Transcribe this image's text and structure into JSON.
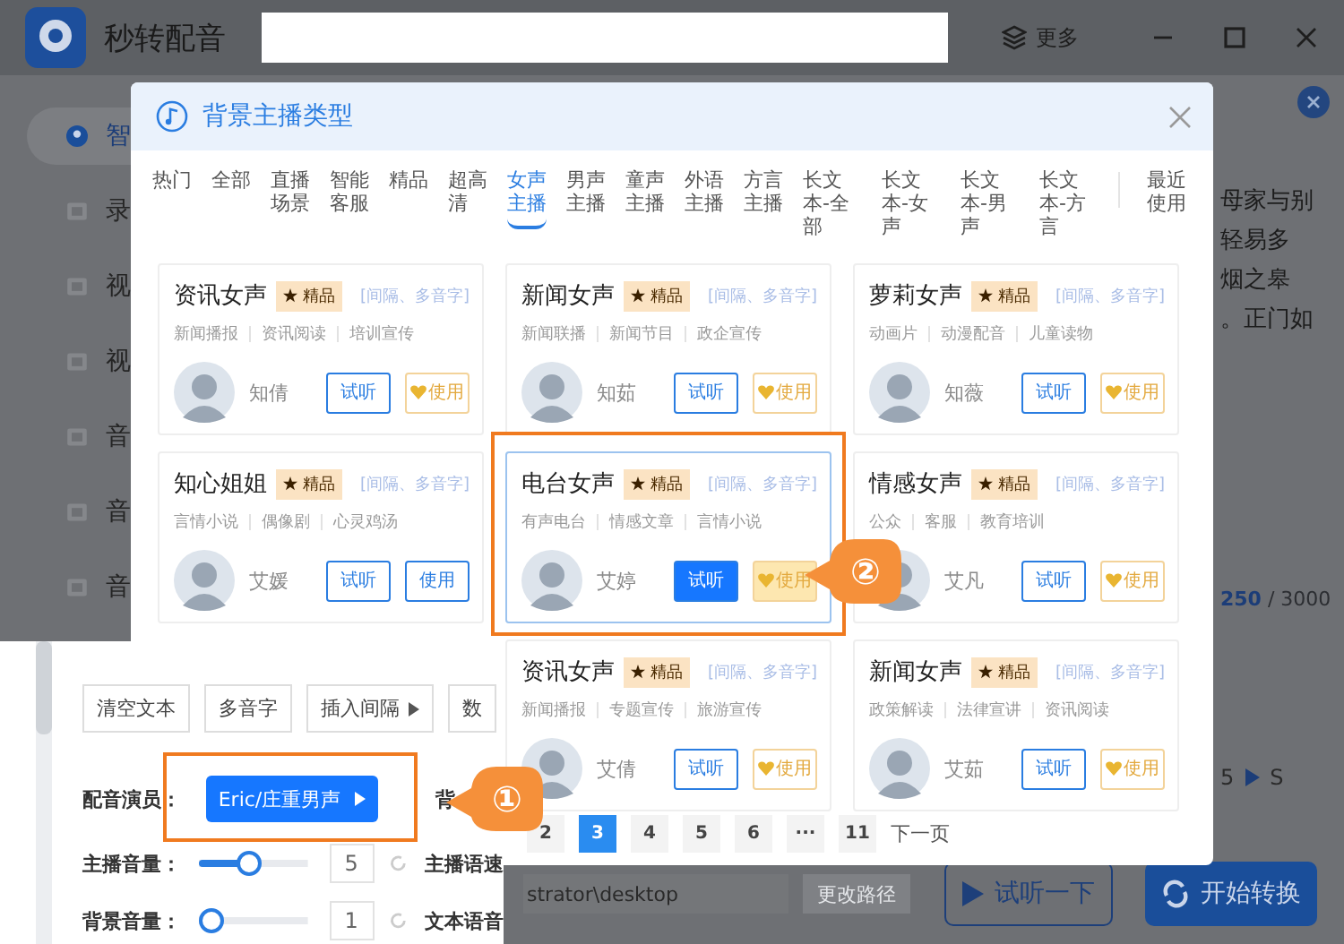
{
  "titlebar": {
    "app_name": "秒转配音",
    "more": "更多"
  },
  "sidebar": {
    "items": [
      {
        "label": "智",
        "selected": true
      },
      {
        "label": "录",
        "selected": false
      },
      {
        "label": "视",
        "selected": false
      },
      {
        "label": "视",
        "selected": false
      },
      {
        "label": "音",
        "selected": false
      },
      {
        "label": "音",
        "selected": false
      },
      {
        "label": "音",
        "selected": false
      }
    ]
  },
  "editor": {
    "text_lines": [
      "母家与别",
      "轻易多",
      "烟之皋",
      "。正门如"
    ],
    "counter": "250",
    "counter_max": "/ 3000",
    "step_start": "5",
    "step_end": "S"
  },
  "output": {
    "path": "strator\\desktop",
    "change_path": "更改路径",
    "preview": "试听一下",
    "convert": "开始转换"
  },
  "dialog": {
    "title": "背景主播类型",
    "tabs": [
      {
        "label": "热门",
        "selected": false
      },
      {
        "label": "全部",
        "selected": false
      },
      {
        "label": "直播场景",
        "selected": false
      },
      {
        "label": "智能客服",
        "selected": false
      },
      {
        "label": "精品",
        "selected": false
      },
      {
        "label": "超高清",
        "selected": false
      },
      {
        "label": "女声主播",
        "selected": true
      },
      {
        "label": "男声主播",
        "selected": false
      },
      {
        "label": "童声主播",
        "selected": false
      },
      {
        "label": "外语主播",
        "selected": false
      },
      {
        "label": "方言主播",
        "selected": false
      },
      {
        "label": "长文本-全部",
        "selected": false
      },
      {
        "label": "长文本-女声",
        "selected": false
      },
      {
        "label": "长文本-男声",
        "selected": false
      },
      {
        "label": "长文本-方言",
        "selected": false
      }
    ],
    "recent_tab": {
      "label": "最近使用",
      "selected": false
    },
    "cards": [
      {
        "title": "资讯女声",
        "badge": "精品",
        "hint": "[间隔、多音字]",
        "tags": [
          "新闻播报",
          "资讯阅读",
          "培训宣传"
        ],
        "name": "知倩",
        "preview": "试听",
        "use": "使用",
        "kind": "vip",
        "selected": false
      },
      {
        "title": "新闻女声",
        "badge": "精品",
        "hint": "[间隔、多音字]",
        "tags": [
          "新闻联播",
          "新闻节目",
          "政企宣传"
        ],
        "name": "知茹",
        "preview": "试听",
        "use": "使用",
        "kind": "vip",
        "selected": false
      },
      {
        "title": "萝莉女声",
        "badge": "精品",
        "hint": "[间隔、多音字]",
        "tags": [
          "动画片",
          "动漫配音",
          "儿童读物"
        ],
        "name": "知薇",
        "preview": "试听",
        "use": "使用",
        "kind": "vip",
        "selected": false
      },
      {
        "title": "知心姐姐",
        "badge": "精品",
        "hint": "[间隔、多音字]",
        "tags": [
          "言情小说",
          "偶像剧",
          "心灵鸡汤"
        ],
        "name": "艾媛",
        "preview": "试听",
        "use": "使用",
        "kind": "plain",
        "selected": false
      },
      {
        "title": "电台女声",
        "badge": "精品",
        "hint": "[间隔、多音字]",
        "tags": [
          "有声电台",
          "情感文章",
          "言情小说"
        ],
        "name": "艾婷",
        "preview": "试听",
        "use": "使用",
        "kind": "vip",
        "selected": true
      },
      {
        "title": "情感女声",
        "badge": "精品",
        "hint": "[间隔、多音字]",
        "tags": [
          "公众",
          "客服",
          "教育培训"
        ],
        "name": "艾凡",
        "preview": "试听",
        "use": "使用",
        "kind": "vip",
        "selected": false
      },
      {
        "title": "资讯女声",
        "badge": "精品",
        "hint": "[间隔、多音字]",
        "tags": [
          "新闻播报",
          "专题宣传",
          "旅游宣传"
        ],
        "name": "艾倩",
        "preview": "试听",
        "use": "使用",
        "kind": "vip",
        "selected": false
      },
      {
        "title": "新闻女声",
        "badge": "精品",
        "hint": "[间隔、多音字]",
        "tags": [
          "政策解读",
          "法律宣讲",
          "资讯阅读"
        ],
        "name": "艾茹",
        "preview": "试听",
        "use": "使用",
        "kind": "vip",
        "selected": false
      }
    ],
    "pagination": [
      {
        "label": "2",
        "selected": false
      },
      {
        "label": "3",
        "selected": true
      },
      {
        "label": "4",
        "selected": false
      },
      {
        "label": "5",
        "selected": false
      },
      {
        "label": "6",
        "selected": false
      },
      {
        "label": "···",
        "selected": false
      },
      {
        "label": "11",
        "selected": false
      }
    ],
    "next_page": "下一页"
  },
  "inset": {
    "toolbar": [
      {
        "label": "清空文本",
        "kind": "plain"
      },
      {
        "label": "多音字",
        "kind": "plain"
      },
      {
        "label": "插入间隔",
        "kind": "menu"
      },
      {
        "label": "数",
        "kind": "plain"
      }
    ],
    "voice_actor": {
      "label": "配音演员：",
      "value": "Eric/庄重男声",
      "next_label": "背"
    },
    "sliders": [
      {
        "label": "主播音量：",
        "level": 0.45,
        "value": "5",
        "side_label": "主播语速"
      },
      {
        "label": "背景音量：",
        "level": 0,
        "value": "1",
        "side_label": "文本语音"
      }
    ]
  },
  "callouts": [
    "①",
    "②"
  ]
}
